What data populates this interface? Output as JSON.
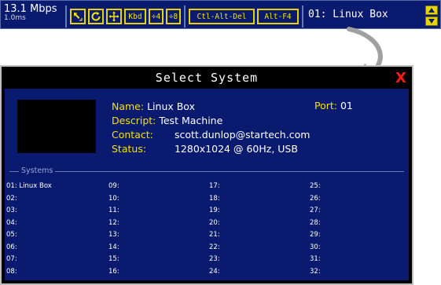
{
  "toolbar": {
    "speed": "13.1 Mbps",
    "latency": "1.0ms",
    "buttons": {
      "cursor_icon": "arrow-cursor-icon",
      "refresh_icon": "refresh-icon",
      "move_icon": "move-icon",
      "kbd": "Kbd",
      "div4": "÷4",
      "div8": "÷8",
      "ctl_alt_del": "Ctl-Alt-Del",
      "alt_f4": "Alt-F4"
    },
    "system_name": "01: Linux Box"
  },
  "dialog": {
    "title": "Select System",
    "close": "X",
    "name_label": "Name:",
    "name_value": "Linux Box",
    "descript_label": "Descript:",
    "descript_value": "Test Machine",
    "contact_label": "Contact:",
    "contact_value": "scott.dunlop@startech.com",
    "status_label": "Status:",
    "status_value": "1280x1024 @ 60Hz, USB",
    "port_label": "Port:",
    "port_value": "01",
    "systems_legend": "Systems",
    "systems": [
      [
        "01: Linux Box",
        "02:",
        "03:",
        "04:",
        "05:",
        "06:",
        "07:",
        "08:"
      ],
      [
        "09:",
        "10:",
        "11:",
        "12:",
        "13:",
        "14:",
        "15:",
        "16:"
      ],
      [
        "17:",
        "18:",
        "19:",
        "20:",
        "21:",
        "22:",
        "23:",
        "24:"
      ],
      [
        "25:",
        "26:",
        "27:",
        "28:",
        "29:",
        "30:",
        "31:",
        "32:"
      ]
    ]
  },
  "colors": {
    "panel_blue": "#0a1a6e",
    "accent_yellow": "#f4e400",
    "close_red": "#ff1a1a"
  }
}
